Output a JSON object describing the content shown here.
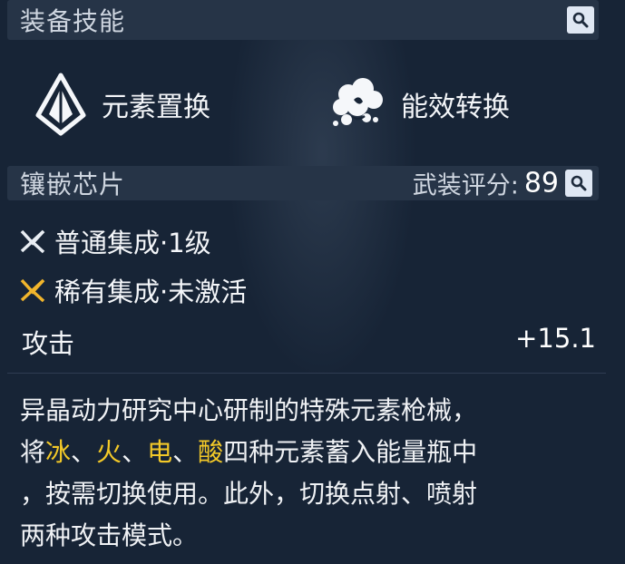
{
  "equipped_skills": {
    "title": "装备技能",
    "skills": [
      {
        "label": "元素置换",
        "icon": "crystal-prism-icon"
      },
      {
        "label": "能效转换",
        "icon": "smoke-burst-icon"
      }
    ]
  },
  "chips": {
    "title": "镶嵌芯片",
    "rating_label": "武装评分:",
    "rating_value": "89",
    "items": [
      {
        "label": "普通集成·1级",
        "icon": "chip-crossed-icon",
        "color": "#e8edf3"
      },
      {
        "label": "稀有集成·未激活",
        "icon": "chip-crossed-icon",
        "color": "#f1b52c"
      }
    ]
  },
  "stat": {
    "name": "攻击",
    "value": "+15.1"
  },
  "description": {
    "line1": "异晶动力研究中心研制的特殊元素枪械，",
    "line2_prefix": "将",
    "elements": [
      "冰",
      "火",
      "电",
      "酸"
    ],
    "separator": "、",
    "line2_suffix": "四种元素蓄入能量瓶中",
    "line3": "，按需切换使用。此外，切换点射、喷射",
    "line4": "两种攻击模式。"
  },
  "colors": {
    "highlight": "#f3c928",
    "panel": "#263447",
    "background": "#172436"
  }
}
